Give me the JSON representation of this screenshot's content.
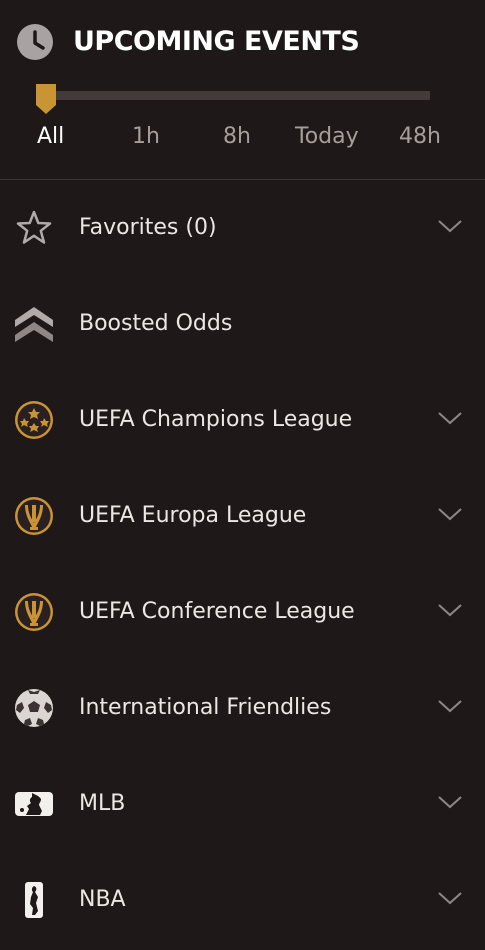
{
  "header": {
    "title": "UPCOMING EVENTS",
    "icon": "clock-icon"
  },
  "time_filter": {
    "options": [
      "All",
      "1h",
      "8h",
      "Today",
      "48h"
    ],
    "selected": "All",
    "accent_color": "#c89434"
  },
  "items": [
    {
      "label": "Favorites (0)",
      "icon": "star-icon",
      "expandable": true
    },
    {
      "label": "Boosted Odds",
      "icon": "boost-chevrons-icon",
      "expandable": false
    },
    {
      "label": "UEFA Champions League",
      "icon": "champions-league-icon",
      "expandable": true
    },
    {
      "label": "UEFA Europa League",
      "icon": "europa-league-icon",
      "expandable": true
    },
    {
      "label": "UEFA Conference League",
      "icon": "conference-league-icon",
      "expandable": true
    },
    {
      "label": "International Friendlies",
      "icon": "soccer-ball-icon",
      "expandable": true
    },
    {
      "label": "MLB",
      "icon": "mlb-logo-icon",
      "expandable": true
    },
    {
      "label": "NBA",
      "icon": "nba-logo-icon",
      "expandable": true
    }
  ],
  "colors": {
    "background": "#1e1819",
    "gold": "#c89434",
    "text": "#ece7e3",
    "muted": "#a79e9a"
  }
}
